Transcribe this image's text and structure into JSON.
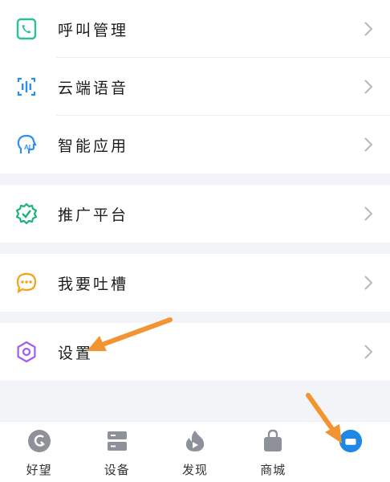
{
  "menu": {
    "group1": [
      {
        "label": "呼叫管理",
        "icon": "phone-call-icon"
      },
      {
        "label": "云端语音",
        "icon": "voice-wave-icon"
      },
      {
        "label": "智能应用",
        "icon": "ai-head-icon"
      }
    ],
    "group2": [
      {
        "label": "推广平台",
        "icon": "verified-badge-icon"
      }
    ],
    "group3": [
      {
        "label": "我要吐槽",
        "icon": "chat-bubble-icon"
      }
    ],
    "group4": [
      {
        "label": "设置",
        "icon": "settings-gear-icon"
      }
    ]
  },
  "tabbar": {
    "items": [
      {
        "label": "好望",
        "icon": "haowang-logo-icon"
      },
      {
        "label": "设备",
        "icon": "device-icon"
      },
      {
        "label": "发现",
        "icon": "discover-flame-icon"
      },
      {
        "label": "商城",
        "icon": "shopping-bag-icon"
      },
      {
        "label": "",
        "icon": "profile-icon"
      }
    ]
  },
  "colors": {
    "teal": "#2bbf9a",
    "blue": "#2e8ef0",
    "green": "#1fb37a",
    "orange": "#f4a21a",
    "purple": "#a15cf0",
    "arrow": "#f39432",
    "tab_gray": "#8e9199",
    "tab_active": "#1e88e5"
  }
}
